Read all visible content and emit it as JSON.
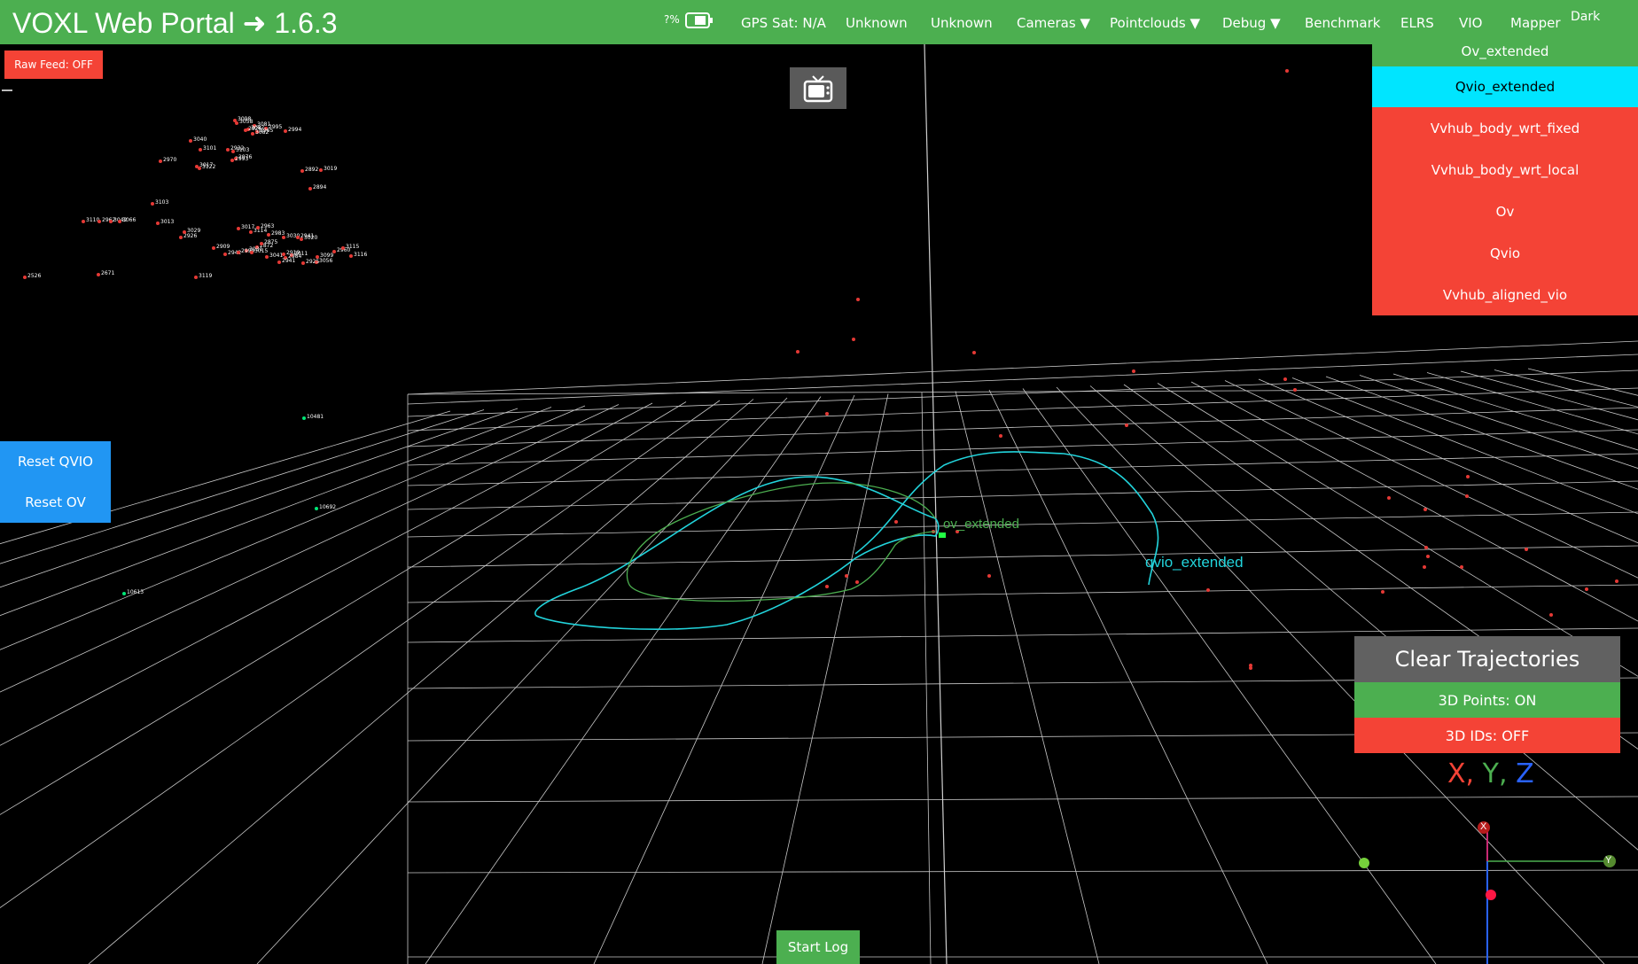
{
  "header": {
    "title": "VOXL Web Portal ➜ 1.6.3",
    "battery": "?%",
    "gps": "GPS Sat: N/A",
    "status1": "Unknown",
    "status2": "Unknown",
    "cameras": "Cameras ▼",
    "pointclouds": "Pointclouds ▼",
    "debug": "Debug ▼",
    "benchmark": "Benchmark",
    "elrs": "ELRS",
    "vio": "VIO",
    "mapper": "Mapper",
    "dark": "Dark"
  },
  "controls": {
    "raw_feed": "Raw Feed: OFF",
    "reset_qvio": "Reset QVIO",
    "reset_ov": "Reset OV",
    "clear_trajectories": "Clear Trajectories",
    "points_3d": "3D Points: ON",
    "ids_3d": "3D IDs: OFF",
    "start_log": "Start Log"
  },
  "dropdown": {
    "items": [
      {
        "label": "Ov_extended",
        "state": "on"
      },
      {
        "label": "Qvio_extended",
        "state": "selected"
      },
      {
        "label": "Vvhub_body_wrt_fixed",
        "state": "off"
      },
      {
        "label": "Vvhub_body_wrt_local",
        "state": "off"
      },
      {
        "label": "Ov",
        "state": "off"
      },
      {
        "label": "Qvio",
        "state": "off"
      },
      {
        "label": "Vvhub_aligned_vio",
        "state": "off"
      }
    ]
  },
  "scene": {
    "ov_label": "ov_extended",
    "qvio_label": "qvio_extended",
    "legend": {
      "x": "X,",
      "y": "Y,",
      "z": "Z"
    },
    "axis_x": "X",
    "axis_y": "Y"
  },
  "features": {
    "red_ids": [
      "3098",
      "3058",
      "3081",
      "3087",
      "2995",
      "2994",
      "2926",
      "2965",
      "3082",
      "3040",
      "3101",
      "3103",
      "2932",
      "2976",
      "2970",
      "3017",
      "3122",
      "2993",
      "2892",
      "3019",
      "2894",
      "3103",
      "3013",
      "3110",
      "2962",
      "3042",
      "3066",
      "2926",
      "3029",
      "3017",
      "3114",
      "2963",
      "2983",
      "3030",
      "2941",
      "3020",
      "2872",
      "2875",
      "2942",
      "2909",
      "3031",
      "2999",
      "2919",
      "3011",
      "2984",
      "3099",
      "2960",
      "3115",
      "3116",
      "3056",
      "2925",
      "2941",
      "3015",
      "3041",
      "2526",
      "2671",
      "3119"
    ],
    "green_ids": [
      "10481",
      "10692",
      "10613"
    ]
  },
  "colors": {
    "header": "#4caf50",
    "on": "#4caf50",
    "off": "#f44336",
    "selected": "#00e5ff",
    "reset": "#2196f3",
    "neutral": "#616161",
    "ov_trajectory": "#4caf50",
    "qvio_trajectory": "#22d4dc",
    "grid": "#cfcfcf"
  },
  "icons": {
    "battery": "battery-icon",
    "tv": "tv-icon"
  }
}
